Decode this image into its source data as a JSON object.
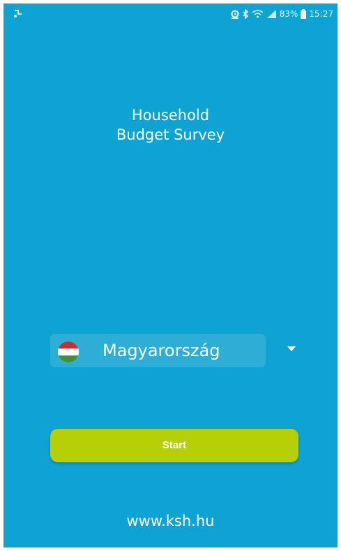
{
  "status_bar": {
    "battery": "83%",
    "time": "15:27",
    "icons": [
      "notification-icon",
      "alarm-icon",
      "bluetooth-icon",
      "wifi-icon",
      "signal-icon",
      "battery-icon"
    ]
  },
  "app": {
    "title_line1": "Household",
    "title_line2": "Budget Survey"
  },
  "country_selector": {
    "selected": "Magyarország",
    "flag": "hungary-flag-icon"
  },
  "start_button": {
    "label": "Start"
  },
  "footer": {
    "website": "www.ksh.hu"
  },
  "colors": {
    "background": "#0ea3d2",
    "button": "#b7cf07",
    "text": "#ffffff"
  }
}
